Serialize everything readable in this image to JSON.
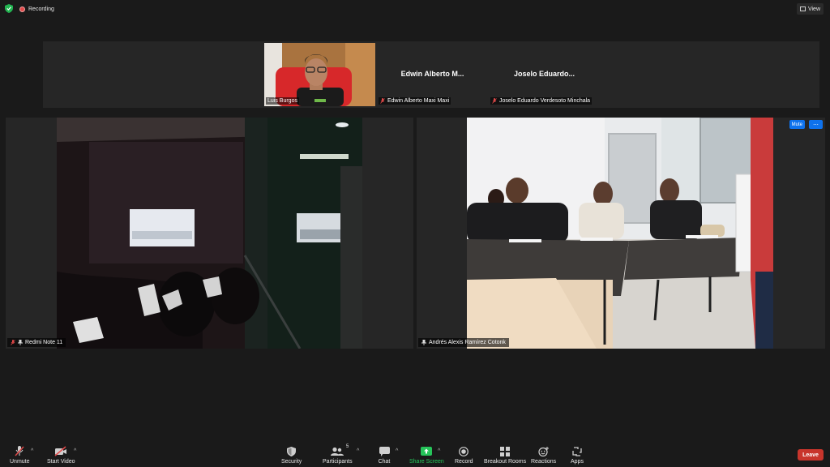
{
  "top": {
    "recording_label": "Recording",
    "view_label": "View"
  },
  "gallery": [
    {
      "name_short": "",
      "name_full": "Luis Burgos",
      "muted": false,
      "has_video": true
    },
    {
      "name_short": "Edwin Alberto M...",
      "name_full": "Edwin Alberto Maxi Maxi",
      "muted": true,
      "has_video": false
    },
    {
      "name_short": "Joselo Eduardo...",
      "name_full": "Joselo Eduardo Verdesoto Minchala",
      "muted": true,
      "has_video": false
    }
  ],
  "tiles": [
    {
      "name": "Redmi Note 11"
    },
    {
      "name": "Andrés Alexis Ramírez Cotonk",
      "mute_label": "Mute",
      "more_label": "..."
    }
  ],
  "toolbar": {
    "unmute": "Unmute",
    "start_video": "Start Video",
    "security": "Security",
    "participants": "Participants",
    "participants_count": "5",
    "chat": "Chat",
    "share_screen": "Share Screen",
    "record": "Record",
    "breakout_rooms": "Breakout Rooms",
    "reactions": "Reactions",
    "apps": "Apps",
    "leave": "Leave"
  },
  "colors": {
    "background": "#1a1a1a",
    "tile": "#262626",
    "accent_blue": "#0e72ed",
    "share_green": "#26c45a",
    "leave_red": "#c8352c"
  }
}
